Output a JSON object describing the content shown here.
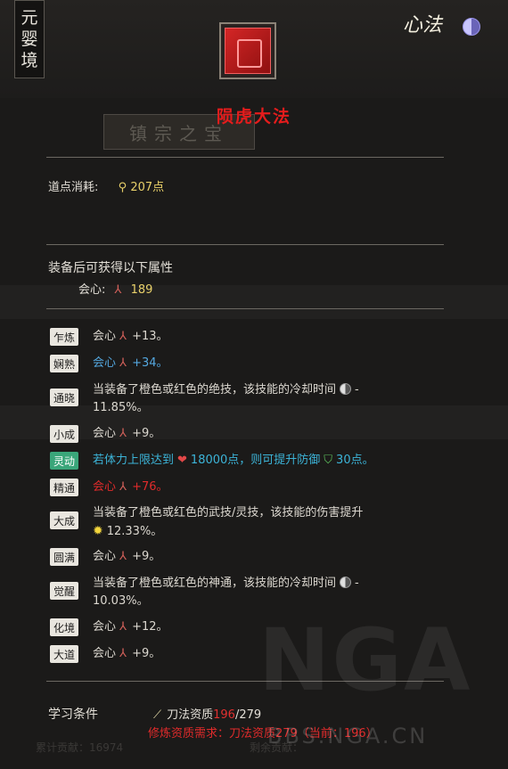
{
  "realm": [
    "元",
    "婴",
    "境"
  ],
  "header": {
    "title": "心法"
  },
  "skill": {
    "name": "陨虎大法"
  },
  "banner": "镇宗之宝",
  "cost": {
    "label": "道点消耗:",
    "value": "207点"
  },
  "attributes": {
    "heading": "装备后可获得以下属性",
    "stat_label": "会心:",
    "stat_value": "189"
  },
  "levels": [
    {
      "label": "乍炼",
      "parts": [
        "会心",
        "+13。"
      ]
    },
    {
      "label": "娴熟",
      "parts": [
        "会心",
        "+34。"
      ]
    },
    {
      "label": "通晓",
      "parts": [
        "当装备了橙色或红色的绝技，该技能的冷却时间",
        "-",
        "11.85%。"
      ]
    },
    {
      "label": "小成",
      "parts": [
        "会心",
        "+9。"
      ]
    },
    {
      "label": "灵动",
      "parts": [
        "若体力上限达到",
        "18000点，则可提升防御",
        "30点。"
      ]
    },
    {
      "label": "精通",
      "parts": [
        "会心",
        "+76。"
      ]
    },
    {
      "label": "大成",
      "parts": [
        "当装备了橙色或红色的武技/灵技，该技能的伤害提升",
        "12.33%。"
      ]
    },
    {
      "label": "圆满",
      "parts": [
        "会心",
        "+9。"
      ]
    },
    {
      "label": "觉醒",
      "parts": [
        "当装备了橙色或红色的神通，该技能的冷却时间",
        "-",
        "10.03%。"
      ]
    },
    {
      "label": "化境",
      "parts": [
        "会心",
        "+12。"
      ]
    },
    {
      "label": "大道",
      "parts": [
        "会心",
        "+9。"
      ]
    }
  ],
  "requirement": {
    "label": "学习条件",
    "stat": "刀法资质",
    "current": "196",
    "sep_total": "/279",
    "note": "修炼资质需求：刀法资质279（当前：196）"
  },
  "watermark": {
    "logo": "NGA",
    "url": "BBS.NGA.CN"
  },
  "background_text": {
    "contribution": "累计贡献：16974",
    "remaining": "剩余贡献："
  },
  "colors": {
    "skill_name": "#e51c1c",
    "active_level": "#3aa67a",
    "blue_text": "#54a8e0",
    "red_text": "#e02b2b"
  }
}
